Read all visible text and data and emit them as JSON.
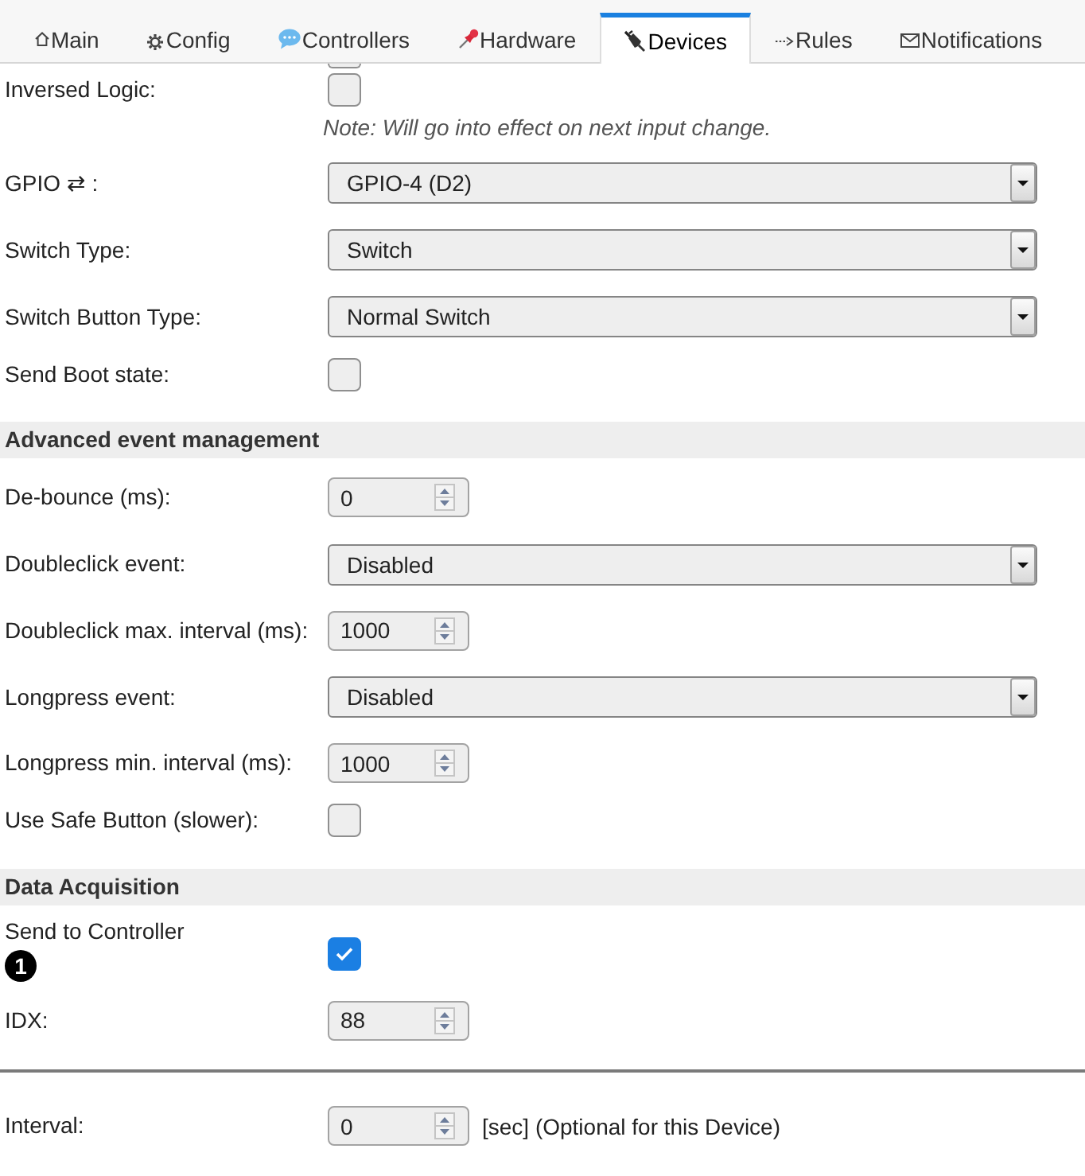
{
  "tabs": [
    {
      "label": "Main",
      "selected": false
    },
    {
      "label": "Config",
      "selected": false
    },
    {
      "label": "Controllers",
      "selected": false
    },
    {
      "label": "Hardware",
      "selected": false
    },
    {
      "label": "Devices",
      "selected": true
    },
    {
      "label": "Rules",
      "selected": false
    },
    {
      "label": "Notifications",
      "selected": false
    }
  ],
  "clipped_checkbox": {
    "checked": false
  },
  "top_rows": [
    {
      "kind": "checkbox",
      "label": "Inversed Logic:",
      "checked": false,
      "note": "Note: Will go into effect on next input change."
    },
    {
      "kind": "select",
      "label": "GPIO ⇄ :",
      "value": "GPIO-4 (D2)"
    },
    {
      "kind": "select",
      "label": "Switch Type:",
      "value": "Switch"
    },
    {
      "kind": "select",
      "label": "Switch Button Type:",
      "value": "Normal Switch"
    },
    {
      "kind": "checkbox",
      "label": "Send Boot state:",
      "checked": false
    }
  ],
  "sections": [
    {
      "title": "Advanced event management",
      "rows": [
        {
          "kind": "number",
          "label": "De-bounce (ms):",
          "value": "0"
        },
        {
          "kind": "select",
          "label": "Doubleclick event:",
          "value": "Disabled"
        },
        {
          "kind": "number",
          "label": "Doubleclick max. interval (ms):",
          "value": "1000"
        },
        {
          "kind": "select",
          "label": "Longpress event:",
          "value": "Disabled"
        },
        {
          "kind": "number",
          "label": "Longpress min. interval (ms):",
          "value": "1000"
        },
        {
          "kind": "checkbox",
          "label": "Use Safe Button (slower):",
          "checked": false
        }
      ]
    },
    {
      "title": "Data Acquisition",
      "rows": [
        {
          "kind": "checkbox",
          "label": "Send to Controller",
          "badge": "1",
          "checked": true
        },
        {
          "kind": "number",
          "label": "IDX:",
          "value": "88"
        }
      ]
    }
  ],
  "footer_rows": [
    {
      "kind": "number",
      "label": "Interval:",
      "value": "0",
      "suffix": "[sec] (Optional for this Device)"
    }
  ]
}
